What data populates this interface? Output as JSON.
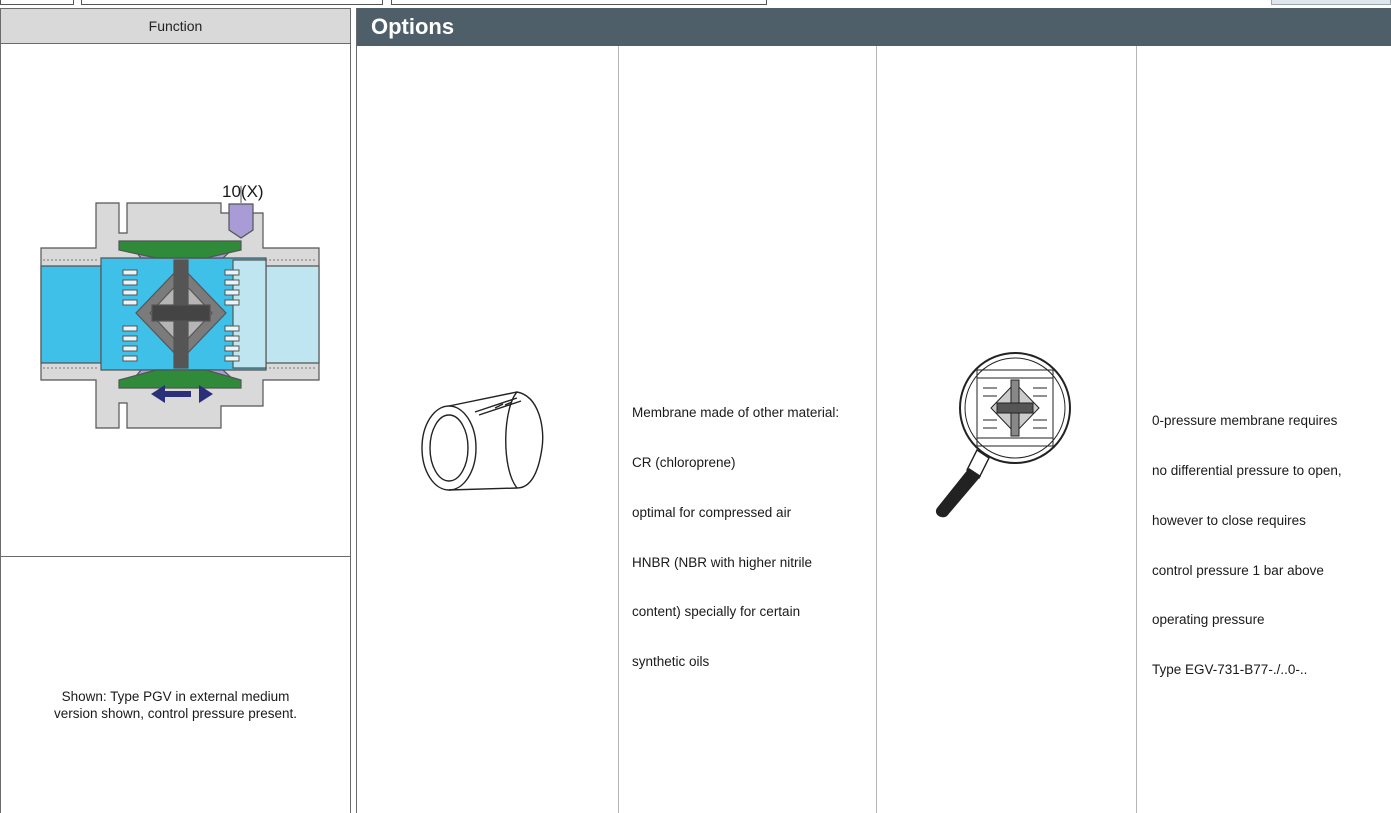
{
  "function_panel": {
    "header": "Function",
    "figure_label": "10(X)",
    "caption_line1": "Shown: Type PGV in external medium",
    "caption_line2": "version shown, control pressure present."
  },
  "options_panel": {
    "header": "Options",
    "option1": {
      "image": "membrane-sleeve",
      "lines": [
        "Membrane made of other material:",
        "CR (chloroprene)",
        "optimal for compressed air",
        "HNBR (NBR with higher nitrile",
        "content) specially for certain",
        "synthetic oils"
      ]
    },
    "option2": {
      "image": "magnifier-valve-detail",
      "lines": [
        "0-pressure membrane requires",
        "no differential pressure to open,",
        "however to close requires",
        "control pressure 1 bar above",
        "operating pressure",
        "Type EGV-731-B77-./..0-.."
      ]
    }
  },
  "colors": {
    "options_header_bg": "#4f5f6a",
    "function_header_bg": "#d9d9d9",
    "medium_cyan": "#3fc0e8",
    "medium_light": "#bfe6f0",
    "membrane_green": "#2f8a3a",
    "control_purple": "#a99bd6",
    "arrow_navy": "#2b2f7a"
  }
}
